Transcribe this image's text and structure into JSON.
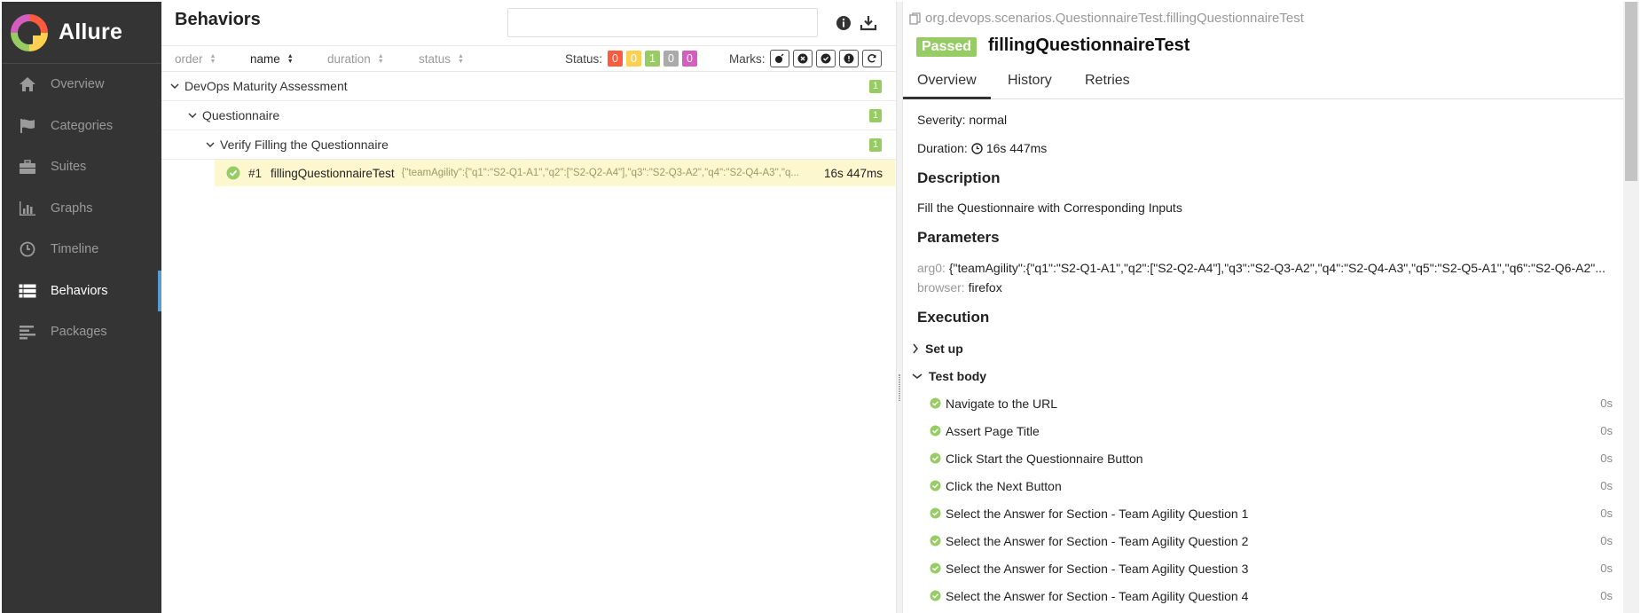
{
  "sidebar": {
    "brand": "Allure",
    "items": [
      {
        "label": "Overview",
        "icon": "home-icon"
      },
      {
        "label": "Categories",
        "icon": "flag-icon"
      },
      {
        "label": "Suites",
        "icon": "briefcase-icon"
      },
      {
        "label": "Graphs",
        "icon": "bar-chart-icon"
      },
      {
        "label": "Timeline",
        "icon": "clock-icon"
      },
      {
        "label": "Behaviors",
        "icon": "list-icon",
        "active": true
      },
      {
        "label": "Packages",
        "icon": "align-left-icon"
      }
    ]
  },
  "middle": {
    "title": "Behaviors",
    "search": {
      "value": "",
      "placeholder": ""
    },
    "sort": {
      "order": "order",
      "name": "name",
      "duration": "duration",
      "status": "status"
    },
    "status_label": "Status:",
    "status_counts": [
      {
        "value": "0",
        "color": "#fd5a3e"
      },
      {
        "value": "0",
        "color": "#ffd050"
      },
      {
        "value": "1",
        "color": "#97cc64"
      },
      {
        "value": "0",
        "color": "#aaaaaa"
      },
      {
        "value": "0",
        "color": "#d35ebe"
      }
    ],
    "marks_label": "Marks:",
    "tree": {
      "epic": {
        "label": "DevOps Maturity Assessment",
        "count": "1"
      },
      "feature": {
        "label": "Questionnaire",
        "count": "1"
      },
      "story": {
        "label": "Verify Filling the Questionnaire",
        "count": "1"
      },
      "leaf": {
        "num": "#1",
        "name": "fillingQuestionnaireTest",
        "params": "{\"teamAgility\":{\"q1\":\"S2-Q1-A1\",\"q2\":[\"S2-Q2-A4\"],\"q3\":\"S2-Q3-A2\",\"q4\":\"S2-Q4-A3\",\"q...",
        "duration": "16s 447ms"
      }
    }
  },
  "right": {
    "breadcrumb": "org.devops.scenarios.QuestionnaireTest.fillingQuestionnaireTest",
    "status": "Passed",
    "title": "fillingQuestionnaireTest",
    "tabs": [
      "Overview",
      "History",
      "Retries"
    ],
    "severity": "Severity: normal",
    "duration_label": "Duration:",
    "duration_value": "16s 447ms",
    "description_heading": "Description",
    "description": "Fill the Questionnaire with Corresponding Inputs",
    "parameters_heading": "Parameters",
    "params": [
      {
        "key": "arg0",
        "value": "{\"teamAgility\":{\"q1\":\"S2-Q1-A1\",\"q2\":[\"S2-Q2-A4\"],\"q3\":\"S2-Q3-A2\",\"q4\":\"S2-Q4-A3\",\"q5\":\"S2-Q5-A1\",\"q6\":\"S2-Q6-A2\"..."
      },
      {
        "key": "browser",
        "value": "firefox"
      }
    ],
    "execution_heading": "Execution",
    "setup_label": "Set up",
    "testbody_label": "Test body",
    "steps": [
      {
        "label": "Navigate to the URL",
        "duration": "0s"
      },
      {
        "label": "Assert Page Title",
        "duration": "0s"
      },
      {
        "label": "Click Start the Questionnaire Button",
        "duration": "0s"
      },
      {
        "label": "Click the Next Button",
        "duration": "0s"
      },
      {
        "label": "Select the Answer for Section - Team Agility Question 1",
        "duration": "0s"
      },
      {
        "label": "Select the Answer for Section - Team Agility Question 2",
        "duration": "0s"
      },
      {
        "label": "Select the Answer for Section - Team Agility Question 3",
        "duration": "0s"
      },
      {
        "label": "Select the Answer for Section - Team Agility Question 4",
        "duration": "0s"
      }
    ]
  }
}
